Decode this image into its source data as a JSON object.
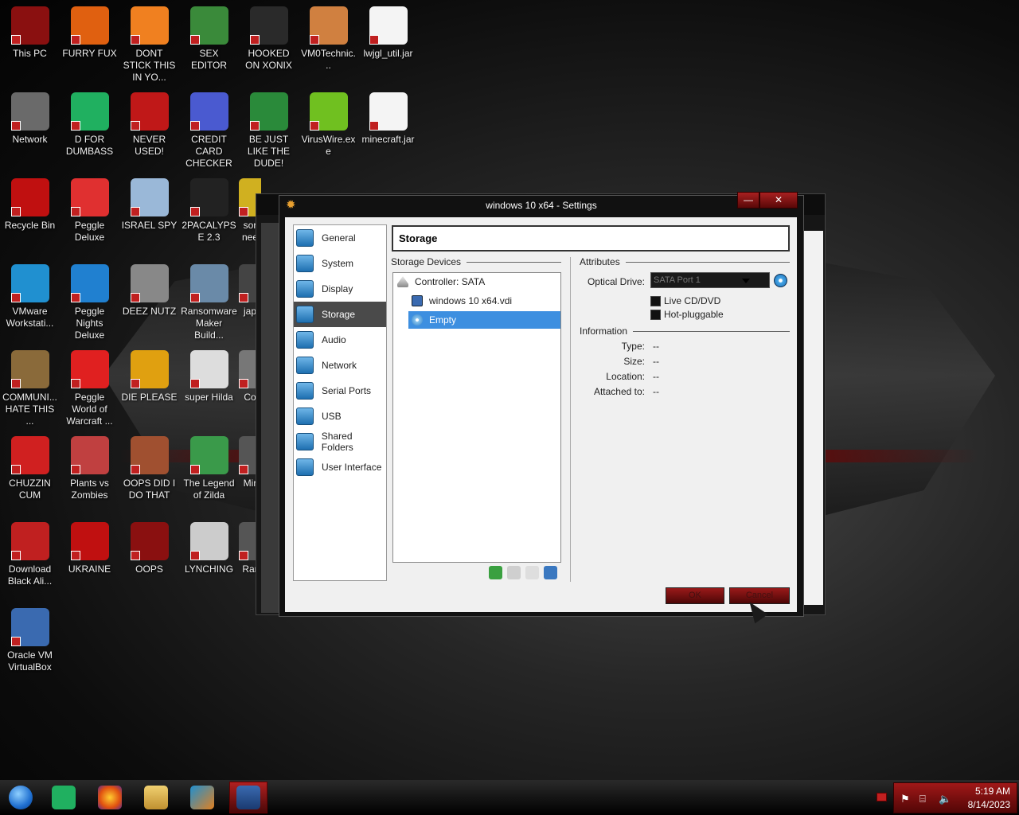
{
  "desktop": {
    "icons": [
      {
        "label": "This PC"
      },
      {
        "label": "FURRY FUX"
      },
      {
        "label": "DONT STICK THIS IN YO..."
      },
      {
        "label": "SEX EDITOR"
      },
      {
        "label": "HOOKED ON XONIX"
      },
      {
        "label": "VM0Technic..."
      },
      {
        "label": "lwjgl_util.jar"
      },
      {
        "label": "Network"
      },
      {
        "label": "D FOR DUMBASS"
      },
      {
        "label": "NEVER USED!"
      },
      {
        "label": "CREDIT CARD CHECKER"
      },
      {
        "label": "BE JUST LIKE THE DUDE!"
      },
      {
        "label": "VirusWire.exe"
      },
      {
        "label": "minecraft.jar"
      },
      {
        "label": "Recycle Bin"
      },
      {
        "label": "Peggle Deluxe"
      },
      {
        "label": "ISRAEL SPY"
      },
      {
        "label": "2PACALYPSE 2.3"
      },
      {
        "label": "sor nee"
      },
      {
        "label": "VMware Workstati..."
      },
      {
        "label": "Peggle Nights Deluxe"
      },
      {
        "label": "DEEZ NUTZ"
      },
      {
        "label": "Ransomware Maker Build..."
      },
      {
        "label": "jap"
      },
      {
        "label": "COMMUNI... HATE THIS ..."
      },
      {
        "label": "Peggle World of Warcraft ..."
      },
      {
        "label": "DIE PLEASE"
      },
      {
        "label": "super Hilda"
      },
      {
        "label": "Co"
      },
      {
        "label": "CHUZZIN CUM"
      },
      {
        "label": "Plants vs Zombies"
      },
      {
        "label": "OOPS DID I DO THAT"
      },
      {
        "label": "The Legend of Zilda"
      },
      {
        "label": "Mir"
      },
      {
        "label": "Download Black Ali..."
      },
      {
        "label": "UKRAINE"
      },
      {
        "label": "OOPS"
      },
      {
        "label": "LYNCHING"
      },
      {
        "label": "Rar"
      },
      {
        "label": "Oracle VM VirtualBox"
      }
    ],
    "icon_colors": [
      "#8a1010",
      "#e06010",
      "#f08020",
      "#3a8a3a",
      "#2a2a2a",
      "#d08040",
      "#f4f4f4",
      "#6a6a6a",
      "#20b060",
      "#c01818",
      "#4a5ad0",
      "#2a8a3a",
      "#70c020",
      "#f4f4f4",
      "#c01010",
      "#e03030",
      "#9ab8d8",
      "#222222",
      "#d0b020",
      "#2090d0",
      "#2080d0",
      "#888888",
      "#6a8aa8",
      "#444444",
      "#8a6a3a",
      "#e02020",
      "#e0a010",
      "#dddddd",
      "#777777",
      "#d02020",
      "#c04040",
      "#a05030",
      "#3a9a4a",
      "#555555",
      "#c02020",
      "#c01010",
      "#8a1010",
      "#cccccc",
      "#555555",
      "#3a6ab0"
    ]
  },
  "dialog": {
    "title": "windows 10 x64 - Settings",
    "titlebar_buttons": [
      "—",
      "✕"
    ],
    "nav": [
      {
        "label": "General",
        "selected": false
      },
      {
        "label": "System",
        "selected": false
      },
      {
        "label": "Display",
        "selected": false
      },
      {
        "label": "Storage",
        "selected": true
      },
      {
        "label": "Audio",
        "selected": false
      },
      {
        "label": "Network",
        "selected": false
      },
      {
        "label": "Serial Ports",
        "selected": false
      },
      {
        "label": "USB",
        "selected": false
      },
      {
        "label": "Shared Folders",
        "selected": false
      },
      {
        "label": "User Interface",
        "selected": false
      }
    ],
    "section_title": "Storage",
    "storage_devices_label": "Storage Devices",
    "tree": {
      "controller": "Controller: SATA",
      "items": [
        {
          "label": "windows 10 x64.vdi",
          "selected": false
        },
        {
          "label": "Empty",
          "selected": true
        }
      ]
    },
    "attributes": {
      "group_label": "Attributes",
      "optical_drive_label": "Optical Drive:",
      "optical_drive_value": "SATA Port 1",
      "live_cd_label": "Live CD/DVD",
      "hot_pluggable_label": "Hot-pluggable"
    },
    "information": {
      "group_label": "Information",
      "rows": [
        {
          "label": "Type:",
          "value": "--"
        },
        {
          "label": "Size:",
          "value": "--"
        },
        {
          "label": "Location:",
          "value": "--"
        },
        {
          "label": "Attached to:",
          "value": "--"
        }
      ]
    },
    "buttons": {
      "ok": "OK",
      "cancel": "Cancel"
    }
  },
  "taskbar": {
    "apps": [
      "start-orb",
      "d-for-dumbass",
      "firefox",
      "file-explorer",
      "vmware-workstation",
      "virtualbox"
    ],
    "clock": {
      "time": "5:19 AM",
      "date": "8/14/2023"
    }
  }
}
